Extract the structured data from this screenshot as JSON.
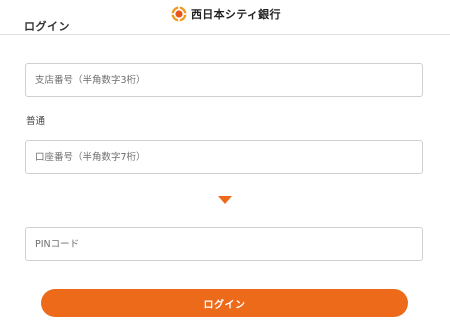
{
  "header": {
    "title": "ログイン",
    "brand_name": "西日本シティ銀行",
    "brand_logo_icon": "bank-logo-icon"
  },
  "form": {
    "branch_number_placeholder": "支店番号（半角数字3桁）",
    "branch_number_value": "",
    "account_type_label": "普通",
    "account_number_placeholder": "口座番号（半角数字7桁）",
    "account_number_value": "",
    "arrow_icon": "triangle-down-icon",
    "pin_placeholder": "PINコード",
    "pin_value": "",
    "login_label": "ログイン"
  },
  "colors": {
    "accent": "#ee6a1b",
    "border": "#cfcfcf",
    "text": "#333333"
  }
}
